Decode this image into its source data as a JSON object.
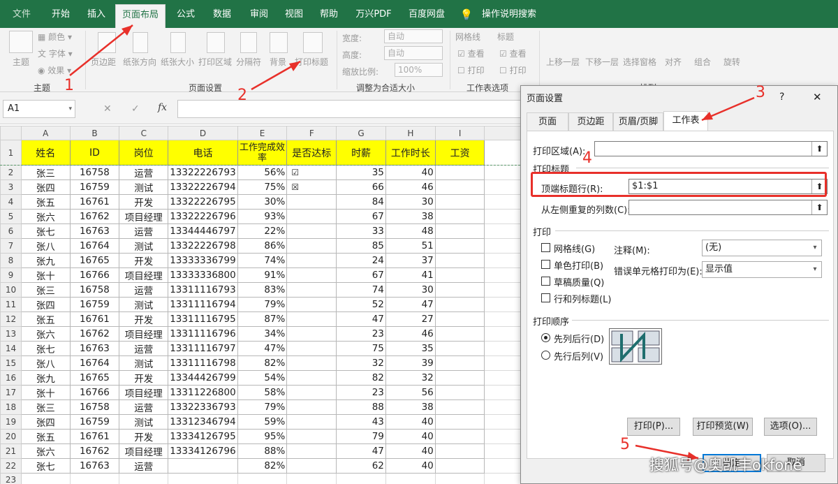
{
  "tabs": [
    "文件",
    "开始",
    "插入",
    "页面布局",
    "公式",
    "数据",
    "审阅",
    "视图",
    "帮助",
    "万兴PDF",
    "百度网盘",
    "操作说明搜索"
  ],
  "ribbon": {
    "theme": {
      "btn": "主题",
      "colors": "颜色",
      "fonts": "字体",
      "effects": "效果",
      "group": "主题"
    },
    "page": {
      "margins": "页边距",
      "orient": "纸张方向",
      "size": "纸张大小",
      "area": "打印区域",
      "breaks": "分隔符",
      "bg": "背景",
      "titles": "打印标题",
      "group": "页面设置"
    },
    "fit": {
      "width_label": "宽度:",
      "width_val": "自动",
      "height_label": "高度:",
      "height_val": "自动",
      "scale_label": "缩放比例:",
      "scale_val": "100%",
      "group": "调整为合适大小"
    },
    "sheet": {
      "grid": "网格线",
      "head": "标题",
      "view1": "查看",
      "print1": "打印",
      "view2": "查看",
      "print2": "打印",
      "group": "工作表选项"
    },
    "arrange": {
      "fwd": "上移一层",
      "back": "下移一层",
      "pane": "选择窗格",
      "align": "对齐",
      "group_btn": "组合",
      "rotate": "旋转",
      "group": "排列"
    }
  },
  "namebox": "A1",
  "fx": "fx",
  "cols": [
    "A",
    "B",
    "C",
    "D",
    "E",
    "F",
    "G",
    "H",
    "I"
  ],
  "header": [
    "姓名",
    "ID",
    "岗位",
    "电话",
    "工作完成效率",
    "是否达标",
    "时薪",
    "工作时长",
    "工资"
  ],
  "rows": [
    [
      "张三",
      "16758",
      "运营",
      "13322226793",
      "56%",
      "☑",
      "35",
      "40"
    ],
    [
      "张四",
      "16759",
      "测试",
      "13322226794",
      "75%",
      "☒",
      "66",
      "46"
    ],
    [
      "张五",
      "16761",
      "开发",
      "13322226795",
      "30%",
      "",
      "84",
      "30"
    ],
    [
      "张六",
      "16762",
      "项目经理",
      "13322226796",
      "93%",
      "",
      "67",
      "38"
    ],
    [
      "张七",
      "16763",
      "运营",
      "13344446797",
      "22%",
      "",
      "33",
      "48"
    ],
    [
      "张八",
      "16764",
      "测试",
      "13322226798",
      "86%",
      "",
      "85",
      "51"
    ],
    [
      "张九",
      "16765",
      "开发",
      "13333336799",
      "74%",
      "",
      "24",
      "37"
    ],
    [
      "张十",
      "16766",
      "项目经理",
      "13333336800",
      "91%",
      "",
      "67",
      "41"
    ],
    [
      "张三",
      "16758",
      "运营",
      "13311116793",
      "83%",
      "",
      "74",
      "30"
    ],
    [
      "张四",
      "16759",
      "测试",
      "13311116794",
      "79%",
      "",
      "52",
      "47"
    ],
    [
      "张五",
      "16761",
      "开发",
      "13311116795",
      "87%",
      "",
      "47",
      "27"
    ],
    [
      "张六",
      "16762",
      "项目经理",
      "13311116796",
      "34%",
      "",
      "23",
      "46"
    ],
    [
      "张七",
      "16763",
      "运营",
      "13311116797",
      "47%",
      "",
      "75",
      "35"
    ],
    [
      "张八",
      "16764",
      "测试",
      "13311116798",
      "82%",
      "",
      "32",
      "39"
    ],
    [
      "张九",
      "16765",
      "开发",
      "13344426799",
      "54%",
      "",
      "82",
      "32"
    ],
    [
      "张十",
      "16766",
      "项目经理",
      "13311226800",
      "58%",
      "",
      "23",
      "56"
    ],
    [
      "张三",
      "16758",
      "运营",
      "13322336793",
      "79%",
      "",
      "88",
      "38"
    ],
    [
      "张四",
      "16759",
      "测试",
      "13312346794",
      "59%",
      "",
      "43",
      "40"
    ],
    [
      "张五",
      "16761",
      "开发",
      "13334126795",
      "95%",
      "",
      "79",
      "40"
    ],
    [
      "张六",
      "16762",
      "项目经理",
      "13334126796",
      "88%",
      "",
      "47",
      "40"
    ],
    [
      "张七",
      "16763",
      "运营",
      "",
      "82%",
      "",
      "62",
      "40"
    ]
  ],
  "dialog": {
    "title": "页面设置",
    "help": "?",
    "close": "✕",
    "tabs": [
      "页面",
      "页边距",
      "页眉/页脚",
      "工作表"
    ],
    "print_area": "打印区域(A):",
    "print_titles": "打印标题",
    "top_rows": "顶端标题行(R):",
    "top_rows_val": "$1:$1",
    "left_cols": "从左侧重复的列数(C):",
    "print": "打印",
    "opt_grid": "网格线(G)",
    "opt_bw": "单色打印(B)",
    "opt_draft": "草稿质量(Q)",
    "opt_rc": "行和列标题(L)",
    "comments_label": "注释(M):",
    "comments_val": "(无)",
    "errors_label": "错误单元格打印为(E):",
    "errors_val": "显示值",
    "order": "打印顺序",
    "order1": "先列后行(D)",
    "order2": "先行后列(V)",
    "btn_print": "打印(P)...",
    "btn_preview": "打印预览(W)",
    "btn_options": "选项(O)...",
    "btn_ok": "确定",
    "btn_cancel": "取消"
  },
  "annotations": [
    "1",
    "2",
    "3",
    "4",
    "5"
  ],
  "watermark": "搜狐号@奥凯丰okfone",
  "colors": {
    "excel_green": "#217346",
    "header_yellow": "#ffff00",
    "annotation_red": "#e8302a"
  }
}
